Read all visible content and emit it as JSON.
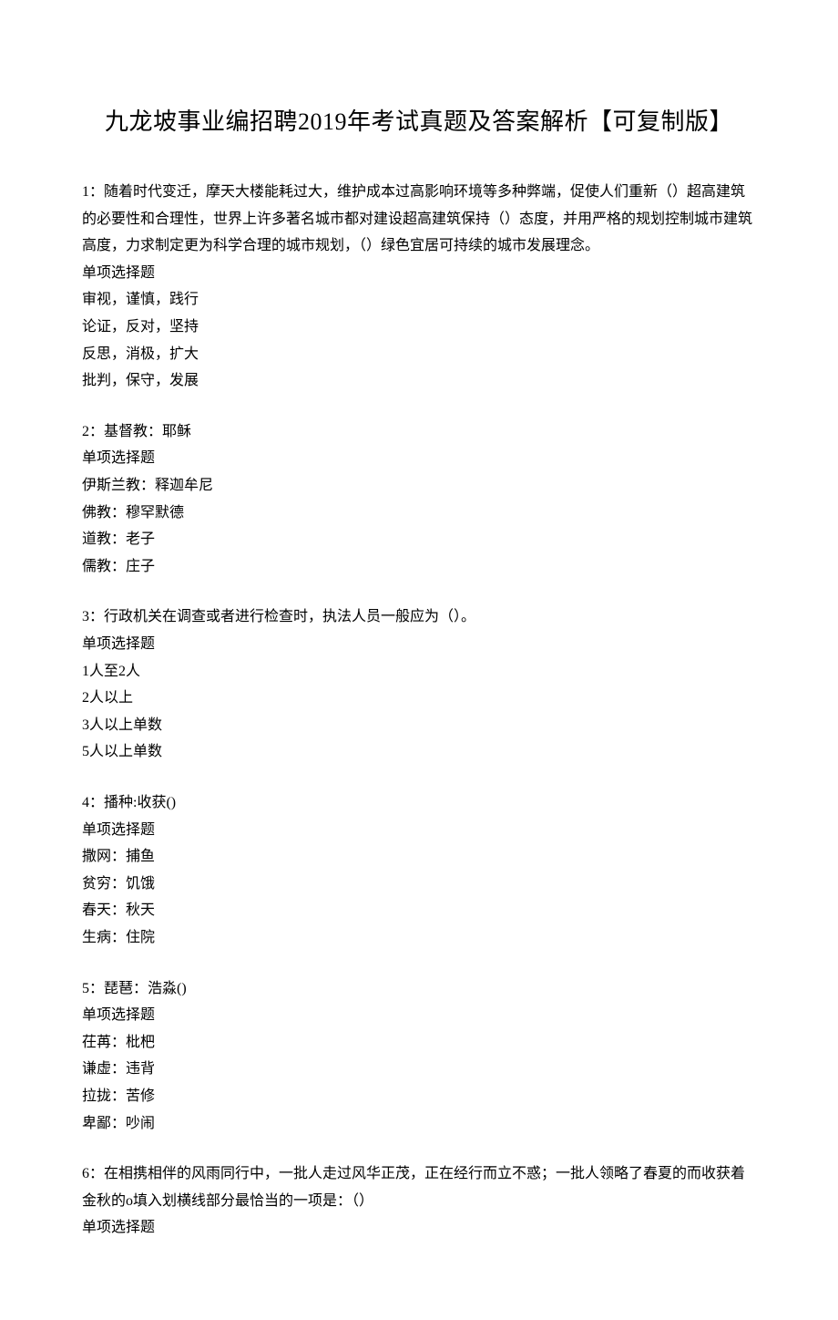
{
  "title": "九龙坡事业编招聘2019年考试真题及答案解析【可复制版】",
  "questions": [
    {
      "stem": "1：随着时代变迁，摩天大楼能耗过大，维护成本过高影响环境等多种弊端，促使人们重新（）超高建筑的必要性和合理性，世界上许多著名城市都对建设超高建筑保持（）态度，并用严格的规划控制城市建筑高度，力求制定更为科学合理的城市规划，（）绿色宜居可持续的城市发展理念。",
      "type": "单项选择题",
      "options": [
        "审视，谨慎，践行",
        "论证，反对，坚持",
        "反思，消极，扩大",
        "批判，保守，发展"
      ]
    },
    {
      "stem": "2：基督教：耶稣",
      "type": "单项选择题",
      "options": [
        "伊斯兰教：释迦牟尼",
        "佛教：穆罕默德",
        "道教：老子",
        "儒教：庄子"
      ]
    },
    {
      "stem": "3：行政机关在调查或者进行检查时，执法人员一般应为（）。",
      "type": "单项选择题",
      "options": [
        "1人至2人",
        "2人以上",
        "3人以上单数",
        "5人以上单数"
      ]
    },
    {
      "stem": "4：播种:收获()",
      "type": "单项选择题",
      "options": [
        "撒网：捕鱼",
        "贫穷：饥饿",
        "春天：秋天",
        "生病：住院"
      ]
    },
    {
      "stem": "5：琵琶：浩淼()",
      "type": "单项选择题",
      "options": [
        "茌苒：枇杷",
        "谦虚：违背",
        "拉拢：苦修",
        "卑鄙：吵闹"
      ]
    },
    {
      "stem": "6：在相携相伴的风雨同行中，一批人走过风华正茂，正在经行而立不惑；一批人领略了春夏的而收获着金秋的o填入划横线部分最恰当的一项是：（）",
      "type": "单项选择题",
      "options": []
    }
  ]
}
